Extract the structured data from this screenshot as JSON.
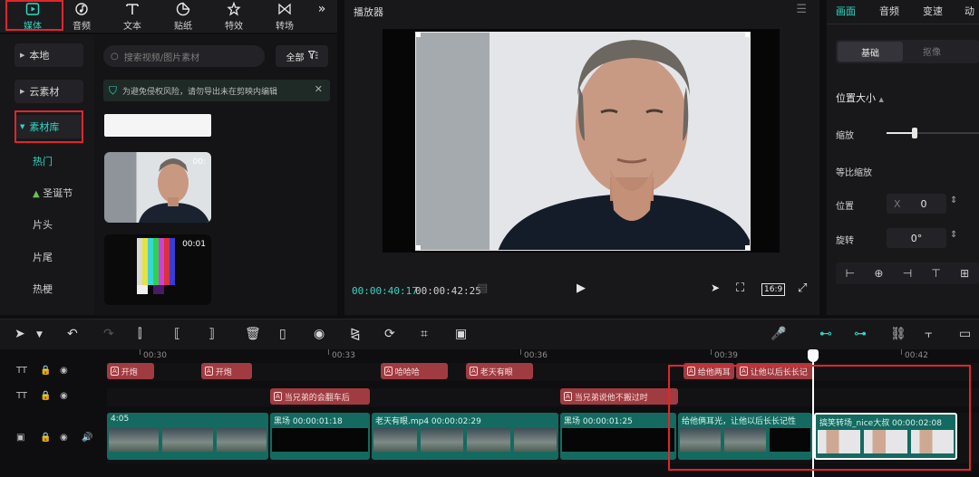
{
  "top_tools": [
    {
      "label": "媒体",
      "icon": "media-icon",
      "active": true
    },
    {
      "label": "音频",
      "icon": "audio-icon",
      "active": false
    },
    {
      "label": "文本",
      "icon": "text-icon",
      "active": false
    },
    {
      "label": "贴纸",
      "icon": "sticker-icon",
      "active": false
    },
    {
      "label": "特效",
      "icon": "effects-icon",
      "active": false
    },
    {
      "label": "转场",
      "icon": "transition-icon",
      "active": false
    }
  ],
  "top_more": "»",
  "left_nav": {
    "local": "本地",
    "cloud": "云素材",
    "library": "素材库",
    "sub_items": [
      "热门",
      "圣诞节",
      "片头",
      "片尾",
      "热梗"
    ]
  },
  "library": {
    "search_placeholder": "搜索视频/图片素材",
    "filter_label": "全部",
    "notice_text": "为避免侵权风险，请勿导出未在剪映内编辑",
    "thumb_face_duration": "00:",
    "thumb_bars_duration": "00:01"
  },
  "player": {
    "title": "播放器",
    "current_time": "00:00:40:17",
    "total_time": "00:00:42:25",
    "ratio": "16:9"
  },
  "right_panel": {
    "tabs": [
      "画面",
      "音频",
      "变速",
      "动"
    ],
    "seg_on": "基础",
    "seg_off": "抠像",
    "section_title": "位置大小",
    "scale_label": "缩放",
    "scale_level": 0.3,
    "uniform_label": "等比缩放",
    "position_label": "位置",
    "position_x_label": "X",
    "position_x_value": "0",
    "rotate_label": "旋转",
    "rotate_value": "0°"
  },
  "timeline": {
    "ruler": [
      "00:30",
      "00:33",
      "00:36",
      "00:39",
      "00:42"
    ],
    "text_track_1": [
      {
        "text": "开炮",
        "left": 0
      },
      {
        "text": "开炮",
        "left": 0
      },
      {
        "text": "哈哈哈",
        "left": 0
      },
      {
        "text": "老天有眼",
        "left": 0
      },
      {
        "text": "给他两耳",
        "left": 0
      },
      {
        "text": "让他以后长长记",
        "left": 0
      }
    ],
    "text_track_2": [
      "当兄弟的会翻车后",
      "当兄弟说他不搬过时"
    ],
    "video_clips": [
      "4:05",
      "黑场  00:00:01:18",
      "老天有眼.mp4  00:00:02:29",
      "黑场  00:00:01:25",
      "给他俩耳光，让他以后长长记性",
      "搞笑转场_nice大叔  00:00:02:08"
    ]
  },
  "colors": {
    "accent": "#2ed8c3",
    "text_clip": "#a03c41",
    "video_clip": "#146a60",
    "highlight": "#e0262b"
  }
}
